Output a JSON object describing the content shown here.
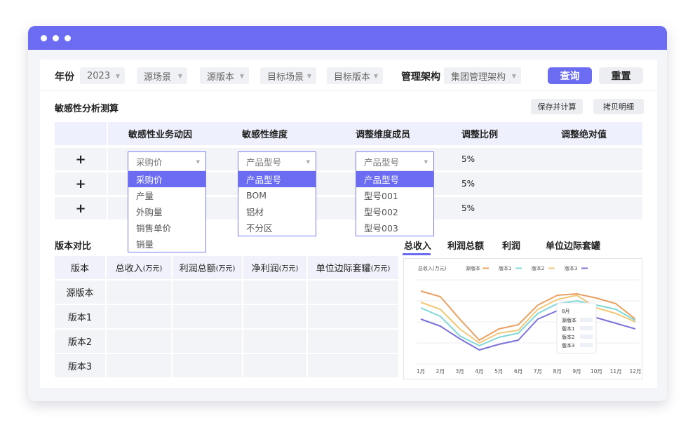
{
  "filters": {
    "year_label": "年份",
    "year_value": "2023",
    "source_scene": "源场景",
    "source_version": "源版本",
    "target_scene": "目标场景",
    "target_version": "目标版本",
    "org_label": "管理架构",
    "org_value": "集团管理架构",
    "query_button": "查询",
    "reset_button": "重置"
  },
  "sensitivity": {
    "title": "敏感性分析测算",
    "save_button": "保存并计算",
    "copy_button": "拷贝明细",
    "headers": [
      "敏感性业务动因",
      "敏感性维度",
      "调整维度成员",
      "调整比例",
      "调整绝对值"
    ],
    "rows": [
      {
        "pct": "5%"
      },
      {
        "pct": "5%"
      },
      {
        "pct": "5%"
      }
    ],
    "dropdown_driver": {
      "value": "采购价",
      "options": [
        "采购价",
        "产量",
        "外购量",
        "销售单价",
        "销量"
      ],
      "active": 0
    },
    "dropdown_dimension": {
      "value": "产品型号",
      "options": [
        "产品型号",
        "BOM",
        "铝材",
        "不分区"
      ],
      "active": 0
    },
    "dropdown_member": {
      "value": "产品型号",
      "options": [
        "产品型号",
        "型号001",
        "型号002",
        "型号003"
      ],
      "active": 0
    }
  },
  "version_compare": {
    "title": "版本对比",
    "headers": [
      "版本",
      "总收入",
      "利润总额",
      "净利润",
      "单位边际套罐"
    ],
    "unit": "(万元)",
    "rows": [
      "源版本",
      "版本1",
      "版本2",
      "版本3"
    ]
  },
  "tabs": [
    "总收入",
    "利润总额",
    "利润",
    "单位边际套罐"
  ],
  "colors": {
    "accent": "#6b6cf2"
  },
  "chart_data": {
    "type": "line",
    "title": "总收入(万元)",
    "x": [
      "1月",
      "2月",
      "3月",
      "4月",
      "5月",
      "6月",
      "7月",
      "8月",
      "9月",
      "10月",
      "11月",
      "12月"
    ],
    "series": [
      {
        "name": "源版本",
        "color": "#e8a063",
        "values": [
          82,
          78,
          62,
          47,
          55,
          58,
          72,
          79,
          80,
          77,
          73,
          62
        ]
      },
      {
        "name": "版本1",
        "color": "#7fd8d6",
        "values": [
          70,
          64,
          50,
          43,
          49,
          52,
          66,
          73,
          75,
          72,
          69,
          61
        ]
      },
      {
        "name": "版本2",
        "color": "#f0c878",
        "values": [
          74,
          69,
          55,
          45,
          52,
          54,
          69,
          76,
          79,
          70,
          66,
          60
        ]
      },
      {
        "name": "版本3",
        "color": "#7a72d8",
        "values": [
          62,
          57,
          48,
          40,
          44,
          47,
          62,
          68,
          65,
          63,
          59,
          55
        ]
      }
    ],
    "tooltip": {
      "title": "8月",
      "labels": [
        "源版本",
        "版本1",
        "版本2",
        "版本3"
      ]
    },
    "ylim": [
      30,
      90
    ],
    "grid": true,
    "legend": "top"
  }
}
